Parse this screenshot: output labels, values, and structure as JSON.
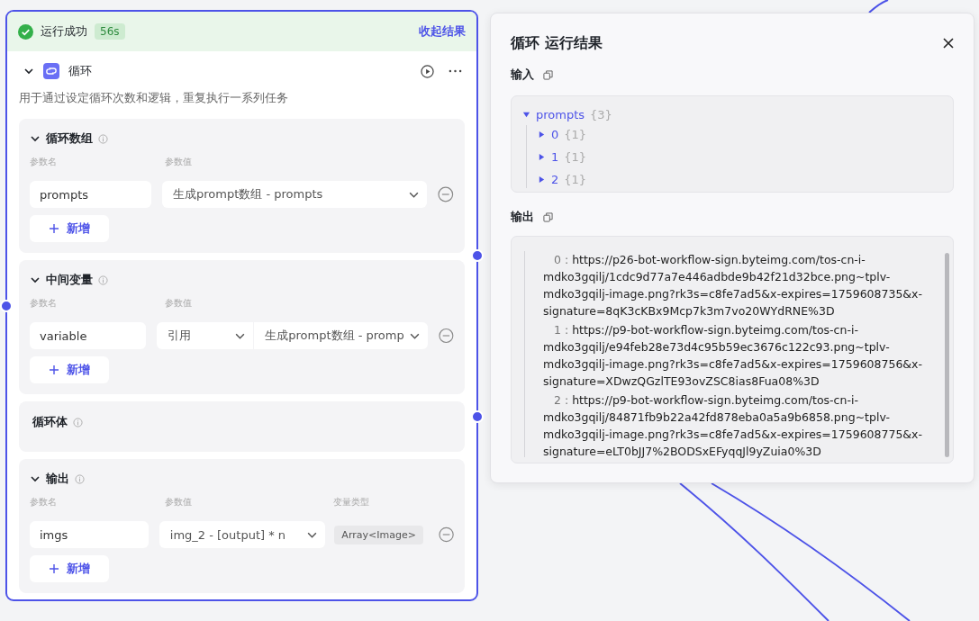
{
  "status": {
    "label": "运行成功",
    "duration": "56s",
    "collapse_link": "收起结果"
  },
  "node": {
    "title": "循环",
    "expanded": true,
    "description": "用于通过设定循环次数和逻辑，重复执行一系列任务"
  },
  "sections": [
    {
      "kind": "params",
      "title": "循环数组",
      "expanded": true,
      "columns": [
        "参数名",
        "参数值"
      ],
      "rows": [
        {
          "kind": "select",
          "name": "prompts",
          "value": "生成prompt数组 - prompts"
        }
      ],
      "add_label": "新增"
    },
    {
      "kind": "params",
      "title": "中间变量",
      "expanded": true,
      "columns": [
        "参数名",
        "参数值"
      ],
      "rows": [
        {
          "kind": "ref",
          "name": "variable",
          "mode": "引用",
          "value": "生成prompt数组 - promp"
        }
      ],
      "add_label": "新增"
    },
    {
      "kind": "body",
      "title": "循环体"
    },
    {
      "kind": "params",
      "title": "输出",
      "expanded": true,
      "columns": [
        "参数名",
        "参数值",
        "变量类型"
      ],
      "rows": [
        {
          "kind": "typed",
          "name": "imgs",
          "value": "img_2 - [output] * n",
          "type": "Array<Image>"
        }
      ],
      "add_label": "新增"
    }
  ],
  "result": {
    "title": "循环 运行结果",
    "input_label": "输入",
    "input_tree": {
      "key": "prompts",
      "count": "{3}",
      "expanded": true,
      "children": [
        {
          "key": "0",
          "count": "{1}",
          "expanded": false
        },
        {
          "key": "1",
          "count": "{1}",
          "expanded": false
        },
        {
          "key": "2",
          "count": "{1}",
          "expanded": false
        }
      ]
    },
    "output_label": "输出",
    "output_items": [
      {
        "index": "0 :",
        "value": "https://p26-bot-workflow-sign.byteimg.com/tos-cn-i-mdko3gqilj/1cdc9d77a7e446adbde9b42f21d32bce.png~tplv-mdko3gqilj-image.png?rk3s=c8fe7ad5&x-expires=1759608735&x-signature=8qK3cKBx9Mcp7k3m7vo20WYdRNE%3D"
      },
      {
        "index": "1 :",
        "value": "https://p9-bot-workflow-sign.byteimg.com/tos-cn-i-mdko3gqilj/e94feb28e73d4c95b59ec3676c122c93.png~tplv-mdko3gqilj-image.png?rk3s=c8fe7ad5&x-expires=1759608756&x-signature=XDwzQGzlTE93ovZSC8ias8Fua08%3D"
      },
      {
        "index": "2 :",
        "value": "https://p9-bot-workflow-sign.byteimg.com/tos-cn-i-mdko3gqilj/84871fb9b22a42fd878eba0a5a9b6858.png~tplv-mdko3gqilj-image.png?rk3s=c8fe7ad5&x-expires=1759608775&x-signature=eLT0bJJ7%2BODSxEFyqqJl9yZuia0%3D"
      }
    ]
  }
}
